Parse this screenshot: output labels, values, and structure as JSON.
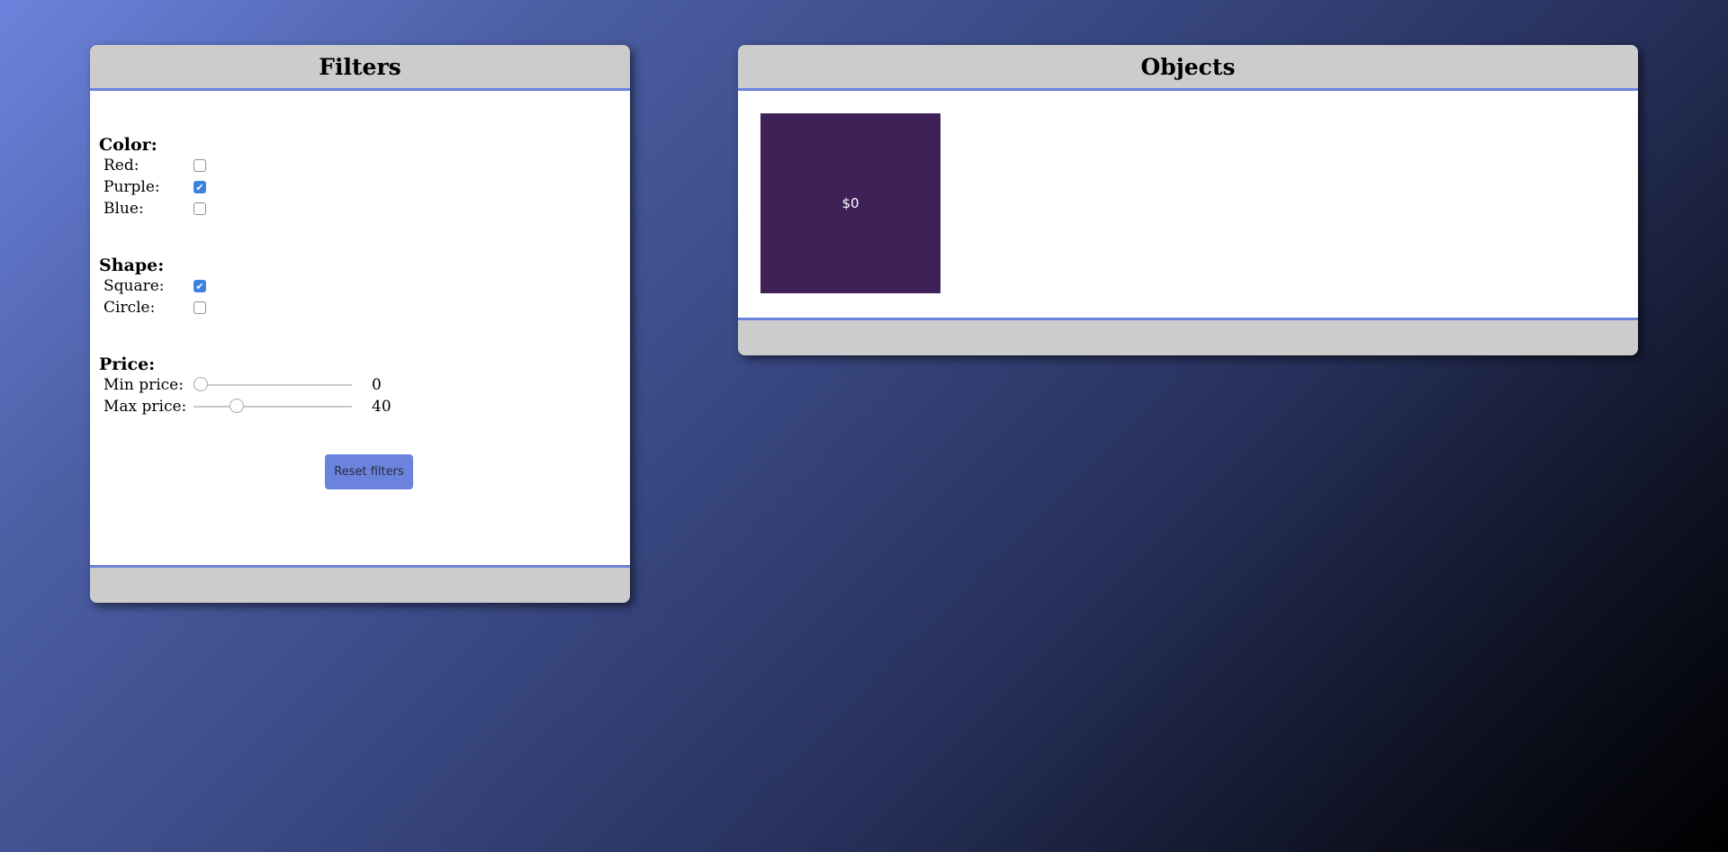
{
  "filters": {
    "title": "Filters",
    "color": {
      "title": "Color:",
      "options": [
        {
          "label": "Red:",
          "checked": false
        },
        {
          "label": "Purple:",
          "checked": true
        },
        {
          "label": "Blue:",
          "checked": false
        }
      ]
    },
    "shape": {
      "title": "Shape:",
      "options": [
        {
          "label": "Square:",
          "checked": true
        },
        {
          "label": "Circle:",
          "checked": false
        }
      ]
    },
    "price": {
      "title": "Price:",
      "min": {
        "label": "Min price:",
        "value": 0,
        "display": "0"
      },
      "max": {
        "label": "Max price:",
        "value": 40,
        "display": "40"
      },
      "range_min": 0,
      "range_max": 160
    },
    "reset_label": "Reset filters"
  },
  "objects": {
    "title": "Objects",
    "items": [
      {
        "price_label": "$0",
        "color": "#3e2157",
        "shape": "square"
      }
    ]
  },
  "colors": {
    "accent": "#6b83dd",
    "checkbox_checked": "#3b82e0",
    "header_bg": "#cccccc"
  }
}
